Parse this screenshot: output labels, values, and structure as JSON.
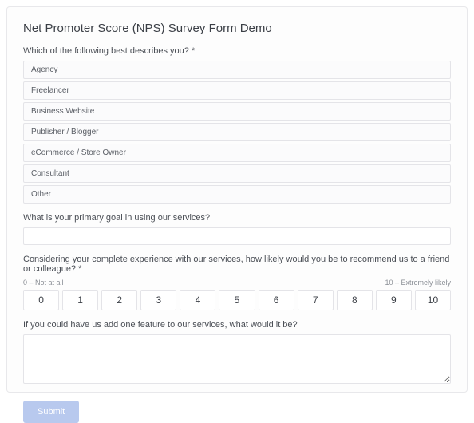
{
  "title": "Net Promoter Score (NPS) Survey Form Demo",
  "q1": {
    "label": "Which of the following best describes you? *",
    "options": [
      "Agency",
      "Freelancer",
      "Business Website",
      "Publisher / Blogger",
      "eCommerce / Store Owner",
      "Consultant",
      "Other"
    ]
  },
  "q2": {
    "label": "What is your primary goal in using our services?",
    "value": ""
  },
  "q3": {
    "label": "Considering your complete experience with our services, how likely would you be to recommend us to a friend or colleague? *",
    "anchor_low": "0 – Not at all",
    "anchor_high": "10 – Extremely likely",
    "scale": [
      "0",
      "1",
      "2",
      "3",
      "4",
      "5",
      "6",
      "7",
      "8",
      "9",
      "10"
    ]
  },
  "q4": {
    "label": "If you could have us add one feature to our services, what would it be?",
    "value": ""
  },
  "submit_label": "Submit"
}
